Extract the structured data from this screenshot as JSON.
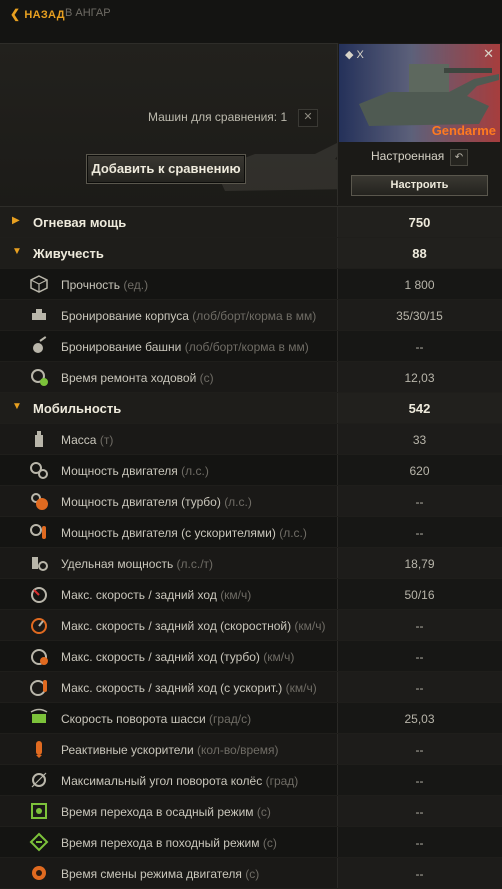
{
  "nav": {
    "back_label": "НАЗАД",
    "hangar_label": "В АНГАР"
  },
  "compare": {
    "count_label": "Машин для сравнения: 1",
    "clear_icon": "close-icon",
    "add_label": "Добавить к сравнению"
  },
  "vehicle": {
    "tier": "X",
    "name": "Gendarme",
    "status": "Настроенная",
    "configure_label": "Настроить",
    "name_color": "#ff7a20"
  },
  "colors": {
    "accent": "#e8a020",
    "muted": "#6f6c65"
  },
  "rows": [
    {
      "type": "category",
      "label": "Огневая мощь",
      "value": "750",
      "expanded": false
    },
    {
      "type": "category",
      "label": "Живучесть",
      "value": "88",
      "expanded": true
    },
    {
      "type": "stat",
      "icon": "cube-icon",
      "label": "Прочность",
      "unit": "(ед.)",
      "value": "1 800"
    },
    {
      "type": "stat",
      "icon": "hull-armor-icon",
      "label": "Бронирование корпуса",
      "unit": "(лоб/борт/корма в мм)",
      "value": "35/30/15"
    },
    {
      "type": "stat",
      "icon": "turret-armor-icon",
      "label": "Бронирование башни",
      "unit": "(лоб/борт/корма в мм)",
      "value": "--"
    },
    {
      "type": "stat",
      "icon": "repair-icon",
      "label": "Время ремонта ходовой",
      "unit": "(с)",
      "value": "12,03"
    },
    {
      "type": "category",
      "label": "Мобильность",
      "value": "542",
      "expanded": true
    },
    {
      "type": "stat",
      "icon": "weight-icon",
      "label": "Масса",
      "unit": "(т)",
      "value": "33"
    },
    {
      "type": "stat",
      "icon": "engine-icon",
      "label": "Мощность двигателя",
      "unit": "(л.с.)",
      "value": "620"
    },
    {
      "type": "stat",
      "icon": "engine-turbo-icon",
      "label": "Мощность двигателя (турбо)",
      "unit": "(л.с.)",
      "value": "--"
    },
    {
      "type": "stat",
      "icon": "engine-boost-icon",
      "label": "Мощность двигателя (с ускорителями)",
      "unit": "(л.с.)",
      "value": "--"
    },
    {
      "type": "stat",
      "icon": "specific-power-icon",
      "label": "Удельная мощность",
      "unit": "(л.с./т)",
      "value": "18,79"
    },
    {
      "type": "stat",
      "icon": "speedometer-icon",
      "label": "Макс. скорость / задний ход",
      "unit": "(км/ч)",
      "value": "50/16"
    },
    {
      "type": "stat",
      "icon": "speedometer-fast-icon",
      "label": "Макс. скорость / задний ход (скоростной)",
      "unit": "(км/ч)",
      "value": "--"
    },
    {
      "type": "stat",
      "icon": "speedometer-turbo-icon",
      "label": "Макс. скорость / задний ход (турбо)",
      "unit": "(км/ч)",
      "value": "--"
    },
    {
      "type": "stat",
      "icon": "speedometer-boost-icon",
      "label": "Макс. скорость / задний ход (с ускорит.)",
      "unit": "(км/ч)",
      "value": "--"
    },
    {
      "type": "stat",
      "icon": "traverse-icon",
      "label": "Скорость поворота шасси",
      "unit": "(град/с)",
      "value": "25,03"
    },
    {
      "type": "stat",
      "icon": "rocket-boost-icon",
      "label": "Реактивные ускорители",
      "unit": "(кол-во/время)",
      "value": "--"
    },
    {
      "type": "stat",
      "icon": "wheel-angle-icon",
      "label": "Максимальный угол поворота колёс",
      "unit": "(град)",
      "value": "--"
    },
    {
      "type": "stat",
      "icon": "siege-mode-icon",
      "label": "Время перехода в осадный режим",
      "unit": "(с)",
      "value": "--"
    },
    {
      "type": "stat",
      "icon": "travel-mode-icon",
      "label": "Время перехода в походный режим",
      "unit": "(с)",
      "value": "--"
    },
    {
      "type": "stat",
      "icon": "engine-mode-icon",
      "label": "Время смены режима двигателя",
      "unit": "(с)",
      "value": "--"
    }
  ]
}
